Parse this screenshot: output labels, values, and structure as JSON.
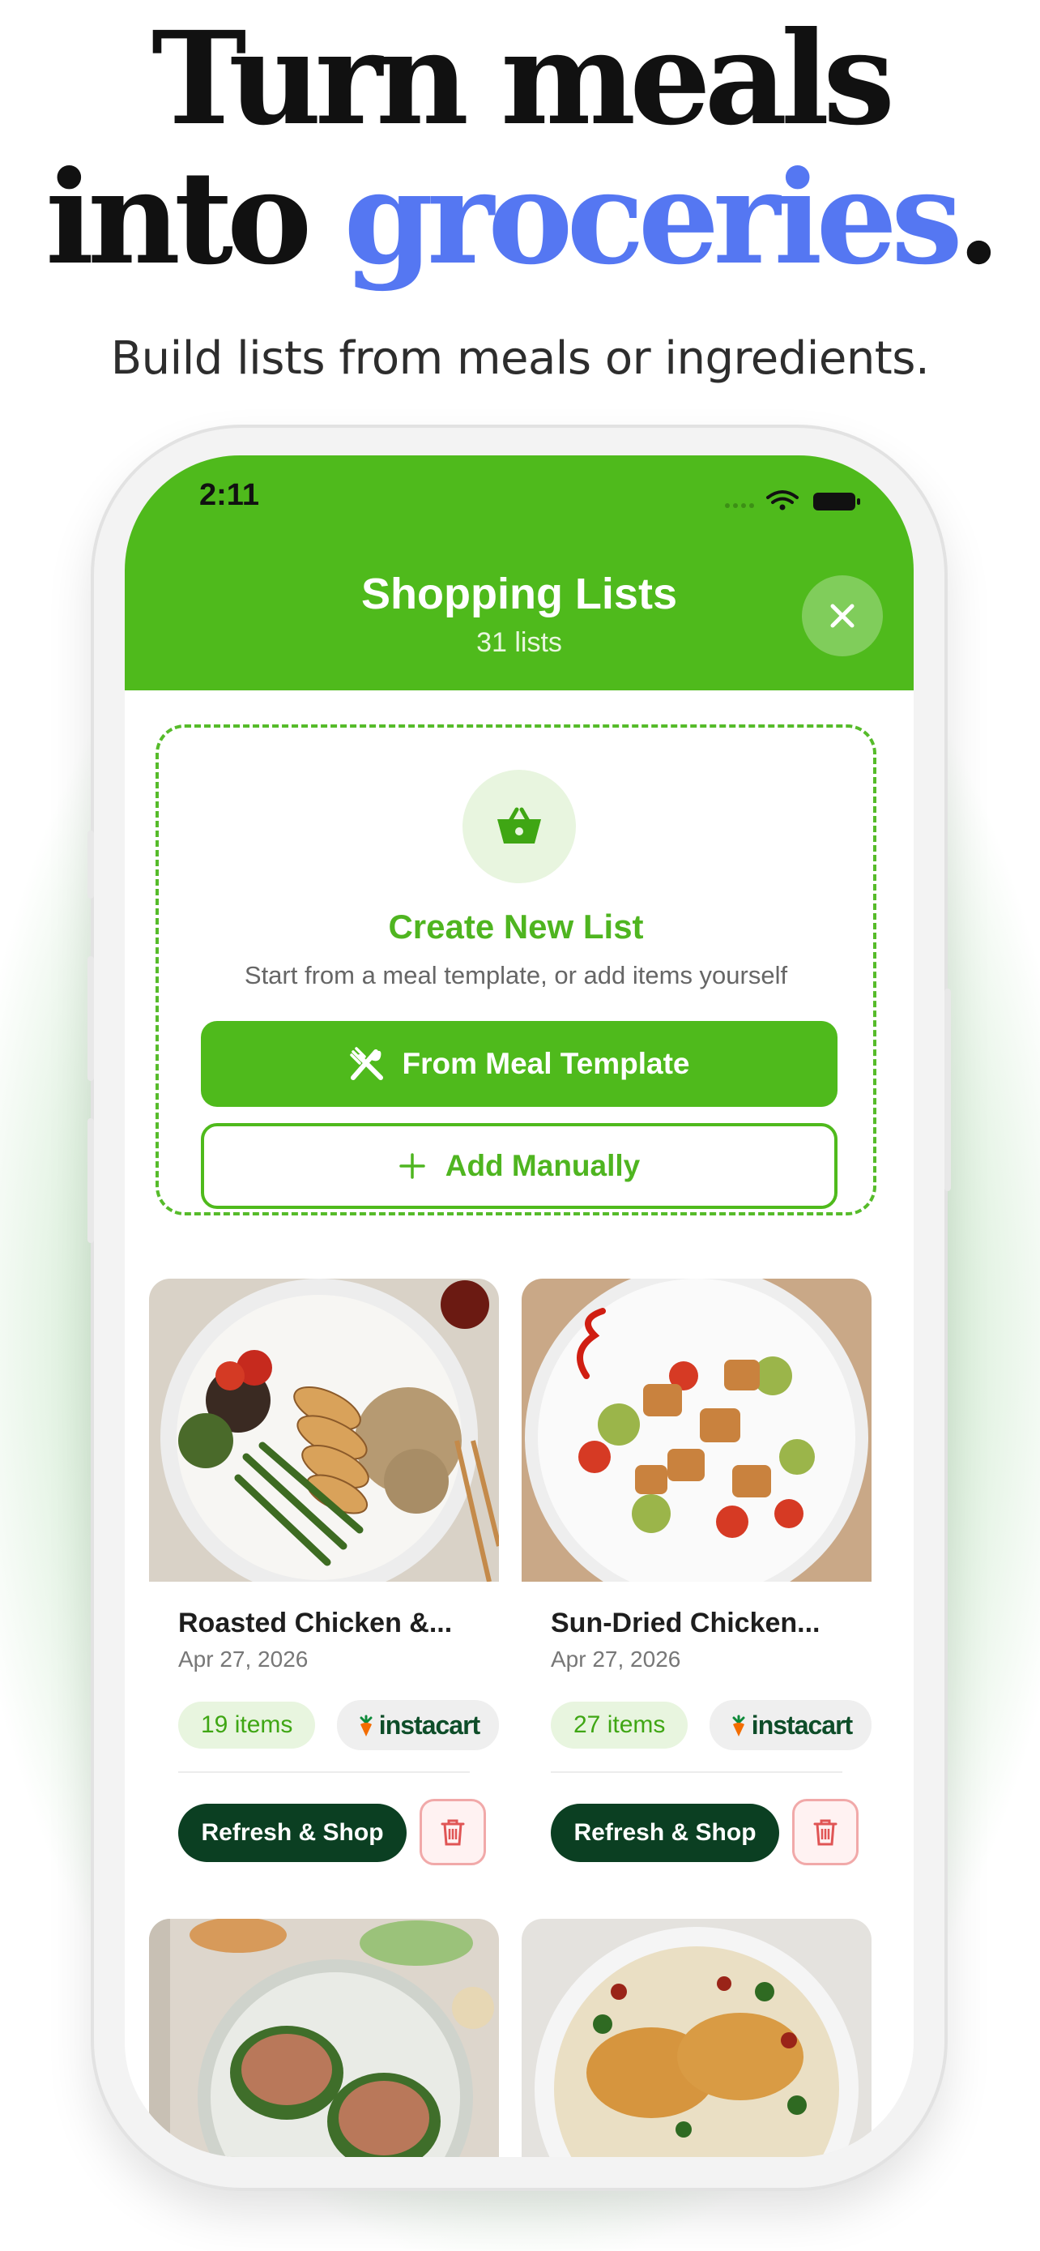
{
  "hero": {
    "line1": "Turn meals",
    "line2_prefix": "into",
    "line2_accent": "groceries",
    "line2_suffix": ".",
    "subhead": "Build lists from meals or ingredients."
  },
  "status_bar": {
    "time": "2:11"
  },
  "header": {
    "title": "Shopping Lists",
    "subtitle": "31 lists"
  },
  "create_card": {
    "title": "Create New List",
    "subtitle": "Start from a meal template, or add items yourself",
    "template_button": "From Meal Template",
    "manual_button": "Add Manually"
  },
  "lists": [
    {
      "title": "Roasted Chicken &...",
      "date": "Apr 27, 2026",
      "items": "19 items",
      "provider": "instacart",
      "action": "Refresh & Shop"
    },
    {
      "title": "Sun-Dried Chicken...",
      "date": "Apr 27, 2026",
      "items": "27 items",
      "provider": "instacart",
      "action": "Refresh & Shop"
    }
  ],
  "colors": {
    "brand_green": "#4fba1c",
    "accent_blue": "#5577f2",
    "dark_green": "#0b3f22",
    "danger_red": "#e05555"
  },
  "icons": [
    "basket-icon",
    "utensils-icon",
    "plus-icon",
    "close-icon",
    "trash-icon",
    "carrot-icon",
    "wifi-icon",
    "battery-icon"
  ]
}
